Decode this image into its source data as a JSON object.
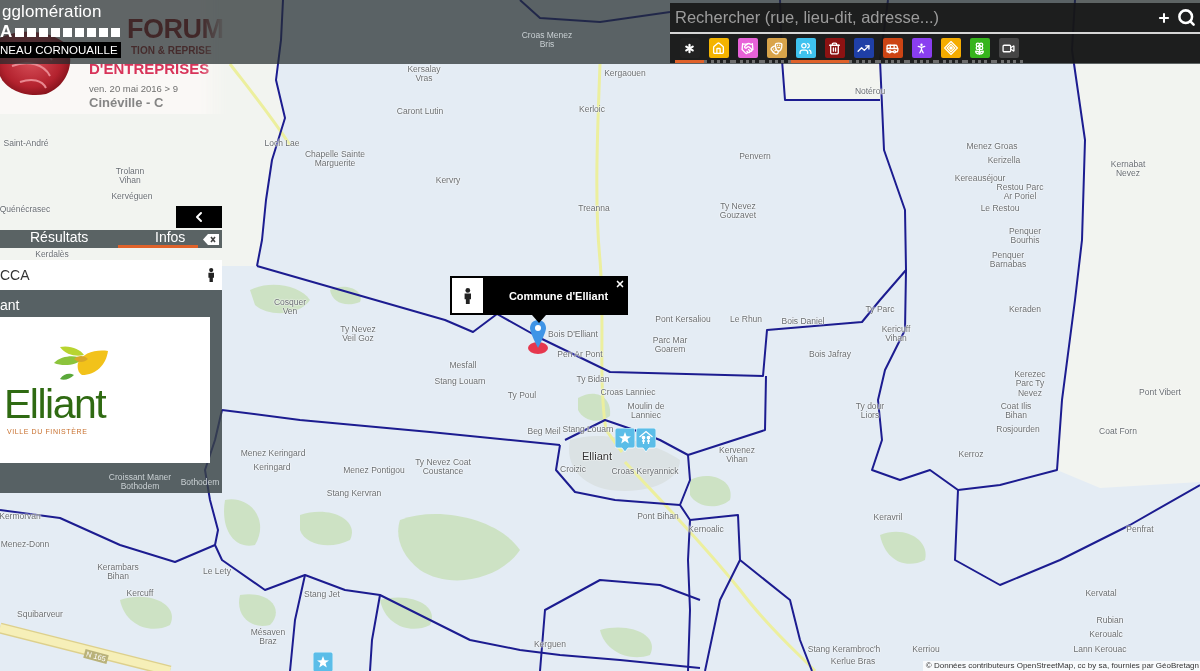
{
  "header": {
    "logo_top": "gglomération",
    "logo_letter": "A",
    "logo_bottom": "NEAU CORNOUAILLE"
  },
  "banner": {
    "title": "FORUM",
    "line_1": "TION & REPRISE",
    "line_2": "D'ENTREPRISES",
    "date": "ven. 20 mai 2016 > 9",
    "venue": "Cinéville - C"
  },
  "search": {
    "placeholder": "Rechercher (rue, lieu-dit, adresse...)"
  },
  "categories": [
    {
      "kind": "asterisk",
      "color": "#222222",
      "selected": true
    },
    {
      "kind": "house",
      "color": "#f4b400",
      "selected": false
    },
    {
      "kind": "handshake",
      "color": "#e862d8",
      "selected": false
    },
    {
      "kind": "masks",
      "color": "#d9a44a",
      "selected": false
    },
    {
      "kind": "children",
      "color": "#3ec2ef",
      "selected": true
    },
    {
      "kind": "trash",
      "color": "#8c1212",
      "selected": true
    },
    {
      "kind": "chart",
      "color": "#1f3fa6",
      "selected": false
    },
    {
      "kind": "bus",
      "color": "#cc4414",
      "selected": false
    },
    {
      "kind": "walker",
      "color": "#8a3ef0",
      "selected": false
    },
    {
      "kind": "target",
      "color": "#f5ac00",
      "selected": false
    },
    {
      "kind": "flower",
      "color": "#36b41c",
      "selected": false
    },
    {
      "kind": "camera",
      "color": "#454545",
      "selected": false
    }
  ],
  "panel": {
    "tabs": [
      {
        "label": "Résultats",
        "selected": false
      },
      {
        "label": "Infos",
        "selected": true
      }
    ],
    "result": "CCA",
    "title": "ant",
    "logo": {
      "name": "Elliant",
      "tagline": "VILLE DU FINISTÈRE"
    }
  },
  "popup": {
    "title": "Commune d'Elliant"
  },
  "map": {
    "places": [
      "Croas Menez Bris",
      "Kersalay Vras",
      "Kergaouen",
      "Notérou",
      "Caront Lutin",
      "Kerloic",
      "Saint-André",
      "Loch Lae",
      "Menez Groas",
      "Chapelle Sainte Marguerite",
      "Penvern",
      "Kerizella",
      "Kernabat Nevez",
      "Trolann Vihan",
      "Kervry",
      "Kereauséjour",
      "Kervéguen",
      "Restou Parc Ar Poriel",
      "Quénécrasec",
      "Treanna",
      "Ty Nevez Gouzavet",
      "Le Restou",
      "Penquer Bourhis",
      "Kerdalès",
      "Penquer Barnabas",
      "Cosquer Ven",
      "Ty Parc",
      "Keraden",
      "Pont Kersaliou",
      "Le Rhun",
      "Bois Daniel",
      "Ty Nevez Veil Goz",
      "Bois D'Elliant",
      "Kericuff Vihan",
      "Parc Mar Goarem",
      "Pen Ar Pont",
      "Bois Jafray",
      "Mesfall",
      "Stang Louarn",
      "Ty Bidan",
      "Kerezec Parc Ty Nevez",
      "Ty Poul",
      "Croas Lanniec",
      "Pont Vibert",
      "Moulin de Lanniec",
      "Ty dour Liors",
      "Coat Ilis Bihan",
      "Beg Meil",
      "Stang Louarn",
      "Rosjourden",
      "Coat Forn",
      "Menez Keringard",
      "Elliant",
      "Kervenez Vihan",
      "Kerroz",
      "Keringard",
      "Menez Pontigou",
      "Ty Nevez Coat Coustance",
      "Croizic",
      "Croas Keryannick",
      "Croissant Maner Bothodem",
      "Bothodem",
      "Stang Kervran",
      "Kermorvan",
      "Pont Bihan",
      "Keravril",
      "Kernoalic",
      "Penfrat",
      "Menez-Donn",
      "Kerambars Bihan",
      "Le Lety",
      "Kercuff",
      "Stang Jet",
      "Kervatal",
      "Squibarveur",
      "Rubian",
      "Mésaven Braz",
      "Keroualc",
      "Kerguen",
      "Stang Kerambroc'h",
      "Kerriou",
      "Lann Kerouac",
      "Kerlue Bras"
    ],
    "road_label": "N 165",
    "markers": [
      {
        "kind": "star"
      },
      {
        "kind": "family"
      },
      {
        "kind": "star"
      }
    ]
  },
  "attribution": "© Données contributeurs OpenStreetMap, cc by sa, fournies par GéoBretagn"
}
